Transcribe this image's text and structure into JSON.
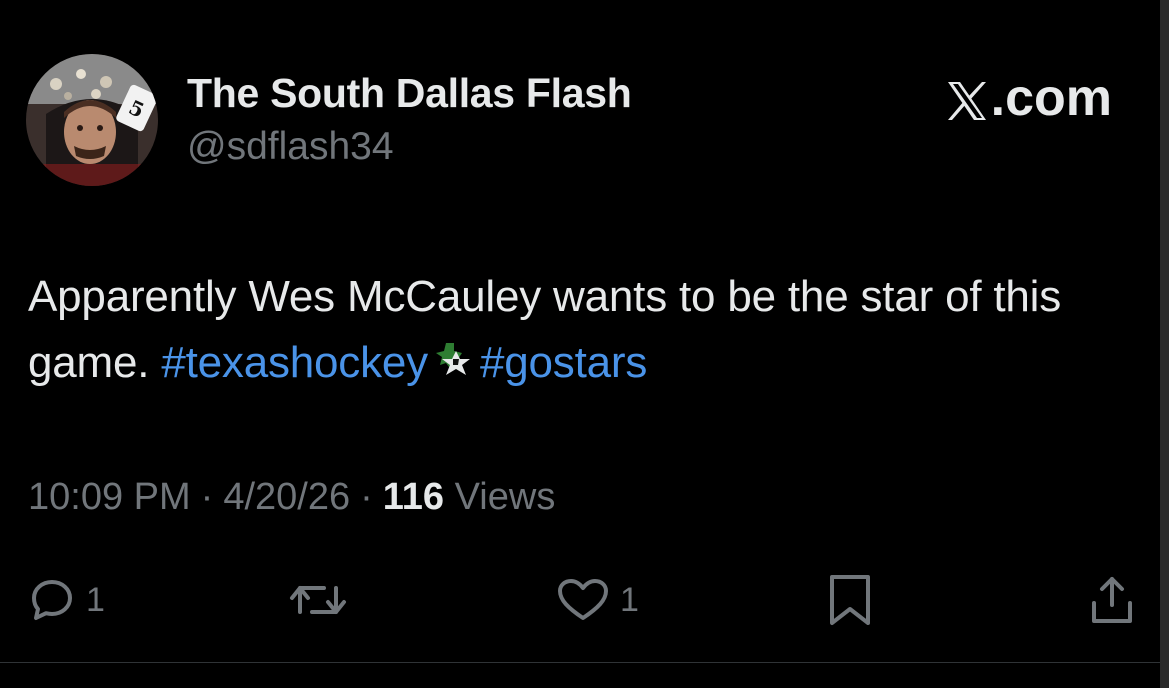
{
  "author": {
    "display_name": "The South Dallas Flash",
    "handle": "@sdflash34",
    "avatar_icon": "user-avatar"
  },
  "brand": {
    "label": ".com",
    "icon": "x-logo-icon"
  },
  "tweet": {
    "text_plain": "Apparently Wes McCauley wants to be the star of this game.",
    "hashtag_1": "#texashockey",
    "hashtag_2": "#gostars",
    "emoji_icon": "dallas-stars-logo-icon"
  },
  "meta": {
    "time": "10:09 PM",
    "date": "4/20/26",
    "views_count": "116",
    "views_label": "Views",
    "separator": "·"
  },
  "actions": {
    "reply_count": "1",
    "like_count": "1"
  },
  "colors": {
    "background": "#000000",
    "text": "#e7e9ea",
    "muted": "#71767b",
    "link": "#4a93e8"
  }
}
